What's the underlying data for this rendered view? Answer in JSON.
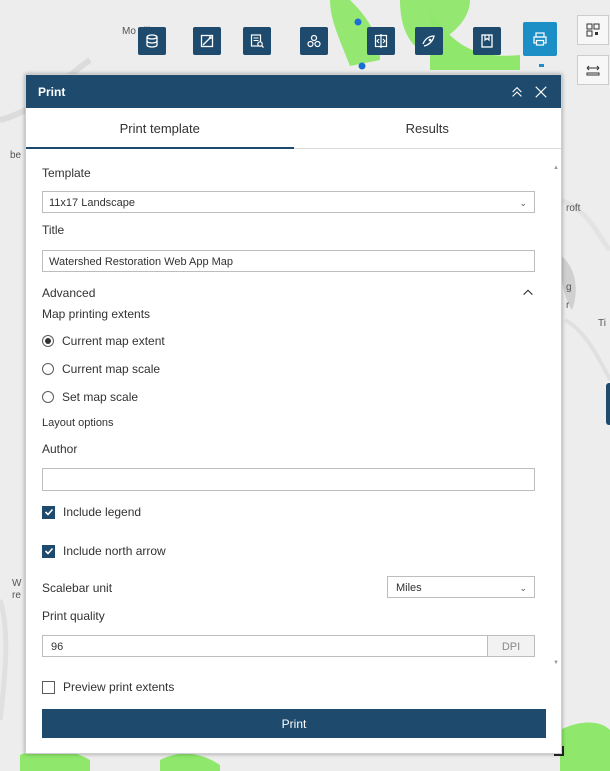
{
  "map": {
    "labels": {
      "top": "Mo        ville",
      "right1": "roft",
      "right2": "Ti",
      "left1": "be",
      "left2": "W",
      "left3": "re",
      "right3": "g",
      "right4": "r"
    }
  },
  "toolbar": {
    "tools": [
      {
        "name": "add-data-tool",
        "icon": "database-icon"
      },
      {
        "name": "measure-tool",
        "icon": "measure-icon"
      },
      {
        "name": "query-tool",
        "icon": "query-icon"
      },
      {
        "name": "analysis-tool",
        "icon": "analysis-icon"
      },
      {
        "name": "swipe-tool",
        "icon": "swipe-icon"
      },
      {
        "name": "draw-tool",
        "icon": "draw-icon"
      },
      {
        "name": "bookmark-tool",
        "icon": "bookmark-icon"
      },
      {
        "name": "print-tool",
        "icon": "print-icon"
      }
    ]
  },
  "panel": {
    "title": "Print",
    "tabs": [
      {
        "label": "Print template",
        "active": true
      },
      {
        "label": "Results",
        "active": false
      }
    ],
    "template": {
      "label": "Template",
      "value": "11x17 Landscape"
    },
    "title_field": {
      "label": "Title",
      "value": "Watershed Restoration Web App Map"
    },
    "advanced": {
      "label": "Advanced"
    },
    "extents": {
      "label": "Map printing extents",
      "options": [
        {
          "label": "Current map extent",
          "checked": true
        },
        {
          "label": "Current map scale",
          "checked": false
        },
        {
          "label": "Set map scale",
          "checked": false
        }
      ]
    },
    "layout_options": {
      "label": "Layout options"
    },
    "author": {
      "label": "Author",
      "value": ""
    },
    "include_legend": {
      "label": "Include legend",
      "checked": true
    },
    "include_north_arrow": {
      "label": "Include north arrow",
      "checked": true
    },
    "scalebar": {
      "label": "Scalebar unit",
      "value": "Miles"
    },
    "print_quality": {
      "label": "Print quality",
      "value": "96",
      "unit": "DPI"
    },
    "preview": {
      "label": "Preview print extents",
      "checked": false
    },
    "print_button": "Print"
  },
  "colors": {
    "header": "#1e4a6e",
    "accent": "#1c8fc7",
    "map_green": "#90ee60"
  }
}
